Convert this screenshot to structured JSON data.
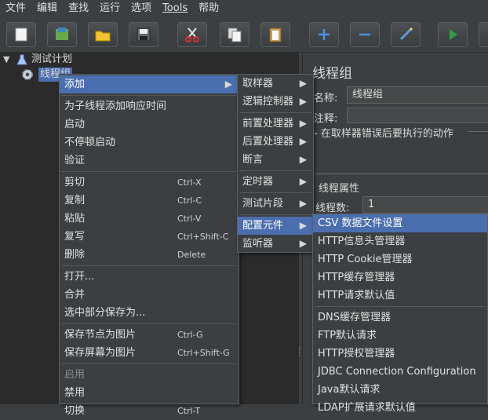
{
  "menubar": [
    {
      "label": "文件"
    },
    {
      "label": "编辑"
    },
    {
      "label": "查找"
    },
    {
      "label": "运行"
    },
    {
      "label": "选项"
    },
    {
      "label": "Tools"
    },
    {
      "label": "帮助"
    }
  ],
  "tree": {
    "root_label": "测试计划",
    "child_label": "线程组"
  },
  "context_menu": {
    "items": [
      {
        "label": "添加",
        "submenu": true,
        "highlight": true
      },
      {
        "sep": true
      },
      {
        "label": "为子线程添加响应时间"
      },
      {
        "label": "启动"
      },
      {
        "label": "不停顿启动"
      },
      {
        "label": "验证"
      },
      {
        "sep": true
      },
      {
        "label": "剪切",
        "shortcut": "Ctrl-X"
      },
      {
        "label": "复制",
        "shortcut": "Ctrl-C"
      },
      {
        "label": "粘贴",
        "shortcut": "Ctrl-V"
      },
      {
        "label": "复写",
        "shortcut": "Ctrl+Shift-C"
      },
      {
        "label": "删除",
        "shortcut": "Delete"
      },
      {
        "sep": true
      },
      {
        "label": "打开..."
      },
      {
        "label": "合并"
      },
      {
        "label": "选中部分保存为..."
      },
      {
        "sep": true
      },
      {
        "label": "保存节点为图片",
        "shortcut": "Ctrl-G"
      },
      {
        "label": "保存屏幕为图片",
        "shortcut": "Ctrl+Shift-G"
      },
      {
        "sep": true
      },
      {
        "label": "启用",
        "disabled": true
      },
      {
        "label": "禁用"
      },
      {
        "label": "切换",
        "shortcut": "Ctrl-T"
      }
    ]
  },
  "add_submenu": {
    "items": [
      {
        "label": "取样器"
      },
      {
        "label": "逻辑控制器"
      },
      {
        "sep": true
      },
      {
        "label": "前置处理器"
      },
      {
        "label": "后置处理器"
      },
      {
        "label": "断言"
      },
      {
        "sep": true
      },
      {
        "label": "定时器"
      },
      {
        "sep": true
      },
      {
        "label": "测试片段"
      },
      {
        "sep": true
      },
      {
        "label": "配置元件",
        "highlight": true
      },
      {
        "label": "监听器"
      }
    ]
  },
  "config_submenu": {
    "items": [
      {
        "label": "CSV 数据文件设置",
        "highlight": true
      },
      {
        "label": "HTTP信息头管理器"
      },
      {
        "label": "HTTP Cookie管理器"
      },
      {
        "label": "HTTP缓存管理器"
      },
      {
        "label": "HTTP请求默认值"
      },
      {
        "sep": true
      },
      {
        "label": "DNS缓存管理器"
      },
      {
        "label": "FTP默认请求"
      },
      {
        "label": "HTTP授权管理器"
      },
      {
        "label": "JDBC Connection Configuration"
      },
      {
        "label": "Java默认请求"
      },
      {
        "label": "LDAP扩展请求默认值"
      }
    ]
  },
  "right_panel": {
    "title": "线程组",
    "name_label": "名称:",
    "name_value": "线程组",
    "comment_label": "注释:",
    "error_action_label": "在取样器错误后要执行的动作",
    "thread_props_label": "线程属性",
    "threads_label": "线程数:",
    "threads_value": "1"
  },
  "colors": {
    "highlight": "#4b6eaf",
    "background": "#3c3f41",
    "tree_bg": "#2b2b2b"
  }
}
